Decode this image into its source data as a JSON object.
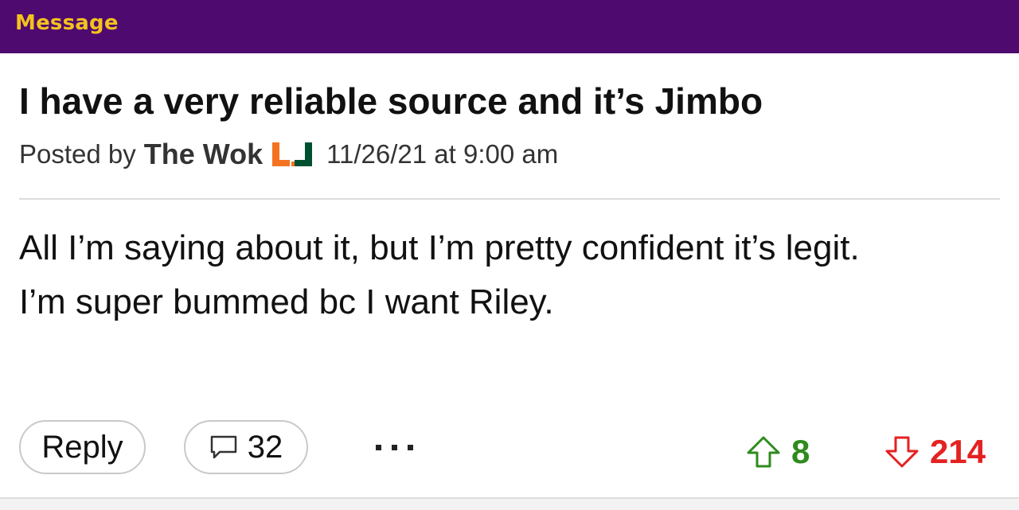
{
  "header": {
    "title": "Message"
  },
  "post": {
    "title": "I have a very reliable source and it’s Jimbo",
    "meta": {
      "posted_by_label": "Posted by",
      "author": "The Wok",
      "team_icon": "miami-u-logo-icon",
      "timestamp": "11/26/21 at 9:00 am"
    },
    "body": [
      "All I’m saying about it, but I’m pretty confident it’s legit.",
      "I’m super bummed bc I want Riley."
    ]
  },
  "actions": {
    "reply_label": "Reply",
    "comment_icon": "speech-bubble-icon",
    "comment_count": "32",
    "more_icon": "more-dots-icon",
    "upvote_icon": "up-arrow-icon",
    "upvotes": "8",
    "downvote_icon": "down-arrow-icon",
    "downvotes": "214"
  },
  "colors": {
    "header_bg": "#4e0a6e",
    "header_text": "#f4c21e",
    "upvote": "#2e8b1e",
    "downvote": "#e32222",
    "logo_orange": "#f47321",
    "logo_green": "#005030"
  }
}
